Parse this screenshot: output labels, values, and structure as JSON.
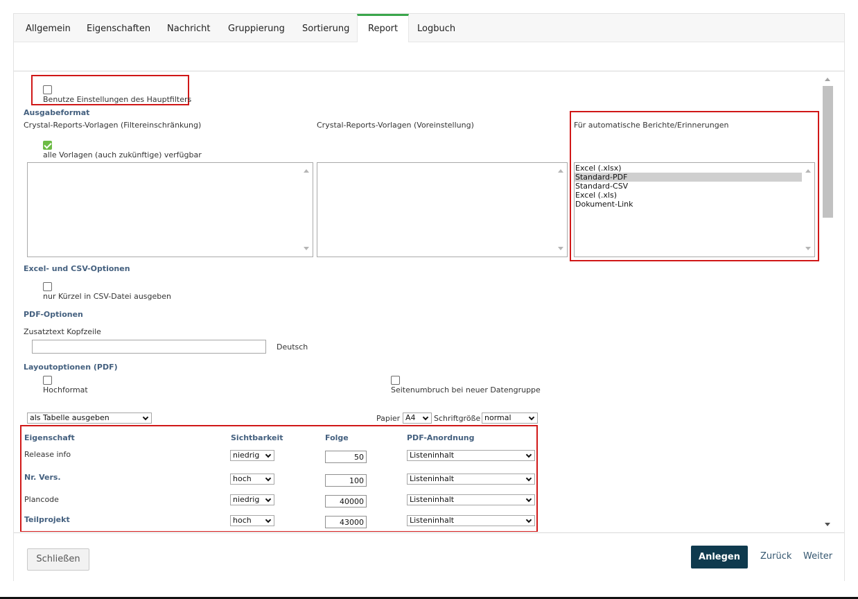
{
  "tabs": [
    {
      "label": "Allgemein",
      "active": false
    },
    {
      "label": "Eigenschaften",
      "active": false
    },
    {
      "label": "Nachricht",
      "active": false
    },
    {
      "label": "Gruppierung",
      "active": false
    },
    {
      "label": "Sortierung",
      "active": false
    },
    {
      "label": "Report",
      "active": true
    },
    {
      "label": "Logbuch",
      "active": false
    }
  ],
  "mainfilter": {
    "label": "Benutze Einstellungen des Hauptfilters",
    "checked": false
  },
  "ausgabeformat": {
    "heading": "Ausgabeformat",
    "col1_label": "Crystal-Reports-Vorlagen (Filtereinschränkung)",
    "col1_checkbox_label": "alle Vorlagen (auch zukünftige) verfügbar",
    "col1_checked": true,
    "col2_label": "Crystal-Reports-Vorlagen (Voreinstellung)",
    "col3_label": "Für automatische Berichte/Erinnerungen",
    "auto_options": [
      "Excel (.xlsx)",
      "Standard-PDF",
      "Standard-CSV",
      "Excel (.xls)",
      "Dokument-Link"
    ],
    "auto_selected": "Standard-PDF"
  },
  "excel_csv": {
    "heading": "Excel- und CSV-Optionen",
    "kuerzel_label": "nur Kürzel in CSV-Datei ausgeben",
    "checked": false
  },
  "pdf": {
    "heading": "PDF-Optionen",
    "kopfzeile_label": "Zusatztext Kopfzeile",
    "kopfzeile_value": "",
    "language": "Deutsch"
  },
  "layout": {
    "heading": "Layoutoptionen (PDF)",
    "hochformat_label": "Hochformat",
    "hochformat_checked": false,
    "seitenumbruch_label": "Seitenumbruch bei neuer Datengruppe",
    "seitenumbruch_checked": false,
    "ausgabe_select": "als Tabelle ausgeben",
    "papier_label": "Papier",
    "papier_value": "A4",
    "schrift_label": "Schriftgröße",
    "schrift_value": "normal"
  },
  "table": {
    "headers": [
      "Eigenschaft",
      "Sichtbarkeit",
      "Folge",
      "PDF-Anordnung"
    ],
    "rows": [
      {
        "name": "Release info",
        "bold": false,
        "sicht": "niedrig",
        "folge": "50",
        "pdf": "Listeninhalt"
      },
      {
        "name": "Nr. Vers.",
        "bold": true,
        "sicht": "hoch",
        "folge": "100",
        "pdf": "Listeninhalt"
      },
      {
        "name": "Plancode",
        "bold": false,
        "sicht": "niedrig",
        "folge": "40000",
        "pdf": "Listeninhalt"
      },
      {
        "name": "Teilprojekt",
        "bold": true,
        "sicht": "hoch",
        "folge": "43000",
        "pdf": "Listeninhalt"
      }
    ]
  },
  "footer": {
    "close": "Schließen",
    "create": "Anlegen",
    "back": "Zurück",
    "next": "Weiter"
  },
  "colors": {
    "accent": "#3aa64b",
    "heading": "#44607f",
    "primary_button": "#0f3a4e",
    "highlight_box": "#d01717"
  }
}
